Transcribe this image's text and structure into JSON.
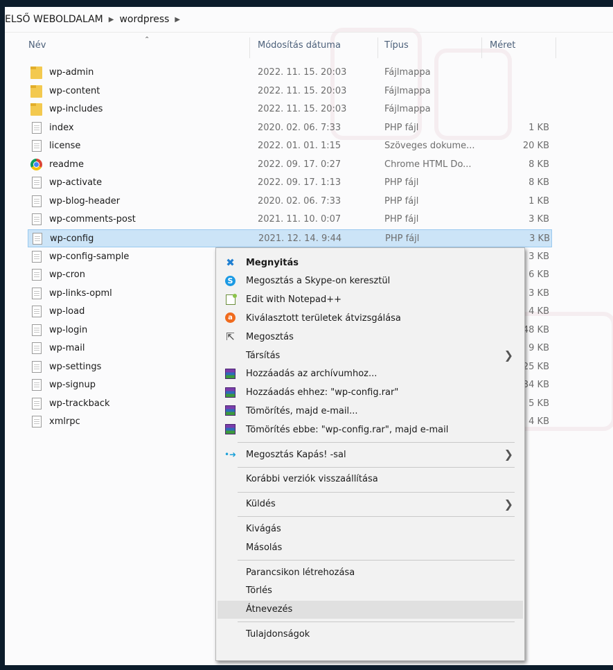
{
  "breadcrumb": [
    "ELSŐ WEBOLDALAM",
    "wordpress"
  ],
  "columns": {
    "name": "Név",
    "date": "Módosítás dátuma",
    "type": "Típus",
    "size": "Méret"
  },
  "files": [
    {
      "name": "wp-admin",
      "date": "2022. 11. 15. 20:03",
      "type": "Fájlmappa",
      "size": "",
      "icon": "folder-icon"
    },
    {
      "name": "wp-content",
      "date": "2022. 11. 15. 20:03",
      "type": "Fájlmappa",
      "size": "",
      "icon": "folder-icon"
    },
    {
      "name": "wp-includes",
      "date": "2022. 11. 15. 20:03",
      "type": "Fájlmappa",
      "size": "",
      "icon": "folder-icon"
    },
    {
      "name": "index",
      "date": "2020. 02. 06. 7:33",
      "type": "PHP fájl",
      "size": "1 KB",
      "icon": "file-icon"
    },
    {
      "name": "license",
      "date": "2022. 01. 01. 1:15",
      "type": "Szöveges dokume...",
      "size": "20 KB",
      "icon": "text-file-icon"
    },
    {
      "name": "readme",
      "date": "2022. 09. 17. 0:27",
      "type": "Chrome HTML Do...",
      "size": "8 KB",
      "icon": "chrome-icon"
    },
    {
      "name": "wp-activate",
      "date": "2022. 09. 17. 1:13",
      "type": "PHP fájl",
      "size": "8 KB",
      "icon": "file-icon"
    },
    {
      "name": "wp-blog-header",
      "date": "2020. 02. 06. 7:33",
      "type": "PHP fájl",
      "size": "1 KB",
      "icon": "file-icon"
    },
    {
      "name": "wp-comments-post",
      "date": "2021. 11. 10. 0:07",
      "type": "PHP fájl",
      "size": "3 KB",
      "icon": "file-icon"
    },
    {
      "name": "wp-config",
      "date": "2021. 12. 14. 9:44",
      "type": "PHP fájl",
      "size": "3 KB",
      "icon": "file-icon",
      "selected": true
    },
    {
      "name": "wp-config-sample",
      "date": "",
      "type": "",
      "size": "3 KB",
      "icon": "file-icon"
    },
    {
      "name": "wp-cron",
      "date": "",
      "type": "",
      "size": "6 KB",
      "icon": "file-icon"
    },
    {
      "name": "wp-links-opml",
      "date": "",
      "type": "",
      "size": "3 KB",
      "icon": "file-icon"
    },
    {
      "name": "wp-load",
      "date": "",
      "type": "",
      "size": "4 KB",
      "icon": "file-icon"
    },
    {
      "name": "wp-login",
      "date": "",
      "type": "",
      "size": "48 KB",
      "icon": "file-icon"
    },
    {
      "name": "wp-mail",
      "date": "",
      "type": "",
      "size": "9 KB",
      "icon": "file-icon"
    },
    {
      "name": "wp-settings",
      "date": "",
      "type": "",
      "size": "25 KB",
      "icon": "file-icon"
    },
    {
      "name": "wp-signup",
      "date": "",
      "type": "",
      "size": "34 KB",
      "icon": "file-icon"
    },
    {
      "name": "wp-trackback",
      "date": "",
      "type": "",
      "size": "5 KB",
      "icon": "file-icon"
    },
    {
      "name": "xmlrpc",
      "date": "",
      "type": "",
      "size": "4 KB",
      "icon": "file-icon"
    }
  ],
  "context_menu": [
    {
      "label": "Megnyitás",
      "icon": "vscode-icon",
      "bold": true
    },
    {
      "label": "Megosztás a Skype-on keresztül",
      "icon": "skype-icon"
    },
    {
      "label": "Edit with Notepad++",
      "icon": "notepadpp-icon"
    },
    {
      "label": "Kiválasztott területek átvizsgálása",
      "icon": "avast-icon"
    },
    {
      "label": "Megosztás",
      "icon": "share-icon"
    },
    {
      "label": "Társítás",
      "submenu": true
    },
    {
      "label": "Hozzáadás az archívumhoz...",
      "icon": "winrar-icon"
    },
    {
      "label": "Hozzáadás ehhez: \"wp-config.rar\"",
      "icon": "winrar-icon"
    },
    {
      "label": "Tömörítés, majd e-mail...",
      "icon": "winrar-icon"
    },
    {
      "label": "Tömörítés ebbe: \"wp-config.rar\", majd e-mail",
      "icon": "winrar-icon"
    },
    {
      "separator": true
    },
    {
      "label": "Megosztás Kapás! -sal",
      "icon": "kapas-icon",
      "submenu": true
    },
    {
      "separator": true
    },
    {
      "label": "Korábbi verziók visszaállítása"
    },
    {
      "separator": true
    },
    {
      "label": "Küldés",
      "submenu": true
    },
    {
      "separator": true
    },
    {
      "label": "Kivágás"
    },
    {
      "label": "Másolás"
    },
    {
      "separator": true
    },
    {
      "label": "Parancsikon létrehozása"
    },
    {
      "label": "Törlés"
    },
    {
      "label": "Átnevezés",
      "hover": true
    },
    {
      "separator": true
    },
    {
      "label": "Tulajdonságok"
    }
  ],
  "colors": {
    "selection": "#cce4f7",
    "menu_bg": "#f2f2f2",
    "folder": "#f3c94f",
    "frame": "#0c1c2b"
  }
}
